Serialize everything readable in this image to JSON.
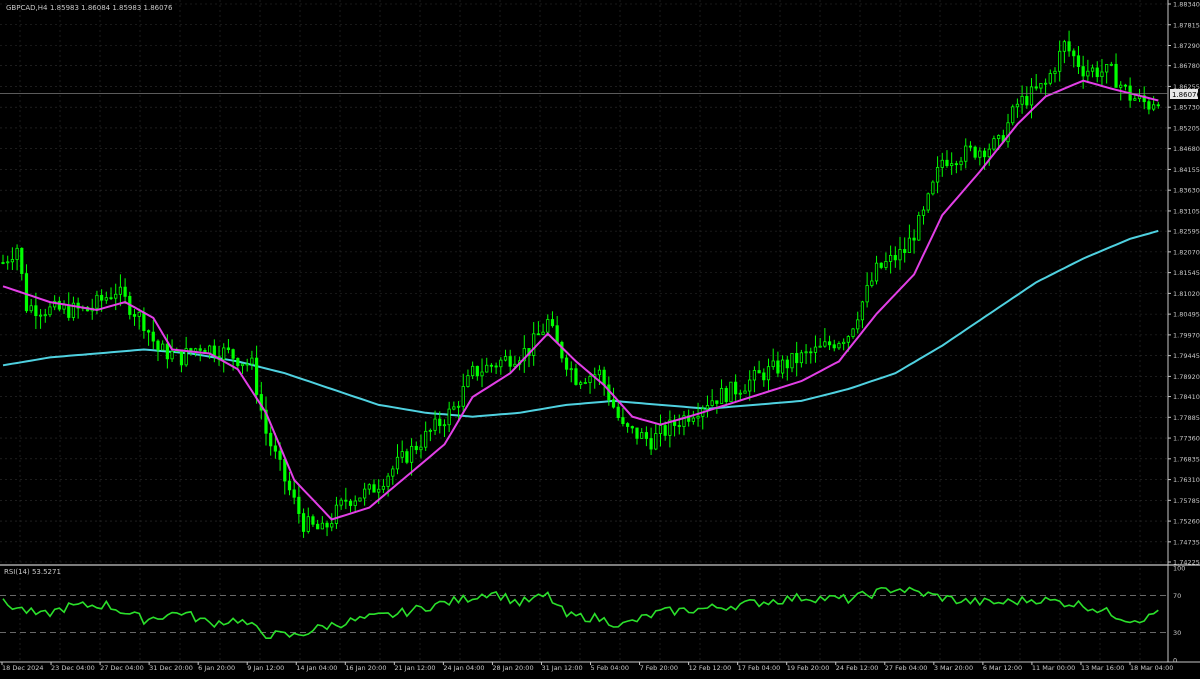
{
  "header": {
    "symbol_timeframe": "GBPCAD,H4",
    "ohlc_text": "1.85983 1.86084 1.85983 1.86076"
  },
  "current_price_label": "1.86076",
  "colors": {
    "background": "#000000",
    "grid": "#2f2f2f",
    "axis_text": "#c8c8c8",
    "candle": "#00ff00",
    "ma_fast": "#e23fe6",
    "ma_slow": "#4fd1e0",
    "rsi_line": "#2be02b",
    "rsi_levels": "#8a8a8a",
    "separator": "#c8c8c8",
    "price_line": "#7a7a7a"
  },
  "price_axis_labels": [
    "1.88340",
    "1.87815",
    "1.87290",
    "1.86780",
    "1.86255",
    "1.85730",
    "1.85205",
    "1.84680",
    "1.84155",
    "1.83630",
    "1.83105",
    "1.82595",
    "1.82070",
    "1.81545",
    "1.81020",
    "1.80495",
    "1.79970",
    "1.79445",
    "1.78920",
    "1.78410",
    "1.77885",
    "1.77360",
    "1.76835",
    "1.76310",
    "1.75785",
    "1.75260",
    "1.74735",
    "1.74225"
  ],
  "time_axis_labels": [
    "18 Dec 2024",
    "23 Dec 04:00",
    "27 Dec 04:00",
    "31 Dec 20:00",
    "6 Jan 20:00",
    "9 Jan 12:00",
    "14 Jan 04:00",
    "16 Jan 20:00",
    "21 Jan 12:00",
    "24 Jan 04:00",
    "28 Jan 20:00",
    "31 Jan 12:00",
    "5 Feb 04:00",
    "7 Feb 20:00",
    "12 Feb 12:00",
    "17 Feb 04:00",
    "19 Feb 20:00",
    "24 Feb 12:00",
    "27 Feb 04:00",
    "3 Mar 20:00",
    "6 Mar 12:00",
    "11 Mar 00:00",
    "13 Mar 16:00",
    "18 Mar 04:00"
  ],
  "rsi": {
    "label": "RSI(14) 53.5271",
    "axis_labels": [
      "100",
      "70",
      "30",
      "0"
    ],
    "levels": [
      70,
      30
    ]
  },
  "chart_data": {
    "type": "candlestick",
    "symbol": "GBPCAD",
    "timeframe": "H4",
    "ylim": [
      1.74225,
      1.8834
    ],
    "last_price": 1.86076,
    "price_path_anchors": [
      [
        0,
        1.818
      ],
      [
        3,
        1.822
      ],
      [
        5,
        1.807
      ],
      [
        10,
        1.806
      ],
      [
        18,
        1.806
      ],
      [
        24,
        1.811
      ],
      [
        30,
        1.803
      ],
      [
        33,
        1.796
      ],
      [
        38,
        1.794
      ],
      [
        42,
        1.797
      ],
      [
        48,
        1.795
      ],
      [
        53,
        1.792
      ],
      [
        56,
        1.775
      ],
      [
        60,
        1.763
      ],
      [
        64,
        1.752
      ],
      [
        68,
        1.75
      ],
      [
        73,
        1.758
      ],
      [
        78,
        1.76
      ],
      [
        84,
        1.767
      ],
      [
        90,
        1.774
      ],
      [
        96,
        1.781
      ],
      [
        100,
        1.79
      ],
      [
        106,
        1.793
      ],
      [
        112,
        1.796
      ],
      [
        116,
        1.803
      ],
      [
        118,
        1.797
      ],
      [
        122,
        1.789
      ],
      [
        127,
        1.79
      ],
      [
        132,
        1.776
      ],
      [
        138,
        1.773
      ],
      [
        144,
        1.778
      ],
      [
        150,
        1.783
      ],
      [
        156,
        1.786
      ],
      [
        162,
        1.79
      ],
      [
        168,
        1.793
      ],
      [
        174,
        1.796
      ],
      [
        180,
        1.8
      ],
      [
        186,
        1.816
      ],
      [
        192,
        1.821
      ],
      [
        196,
        1.83
      ],
      [
        200,
        1.844
      ],
      [
        206,
        1.846
      ],
      [
        212,
        1.848
      ],
      [
        216,
        1.858
      ],
      [
        222,
        1.863
      ],
      [
        226,
        1.873
      ],
      [
        230,
        1.867
      ],
      [
        236,
        1.866
      ],
      [
        240,
        1.86
      ],
      [
        244,
        1.858
      ],
      [
        246,
        1.86
      ]
    ],
    "moving_average_fast": [
      [
        0,
        1.812
      ],
      [
        10,
        1.808
      ],
      [
        20,
        1.806
      ],
      [
        26,
        1.808
      ],
      [
        32,
        1.804
      ],
      [
        36,
        1.796
      ],
      [
        44,
        1.795
      ],
      [
        50,
        1.791
      ],
      [
        56,
        1.78
      ],
      [
        62,
        1.763
      ],
      [
        70,
        1.753
      ],
      [
        78,
        1.756
      ],
      [
        86,
        1.764
      ],
      [
        94,
        1.772
      ],
      [
        100,
        1.784
      ],
      [
        108,
        1.79
      ],
      [
        116,
        1.8
      ],
      [
        122,
        1.793
      ],
      [
        128,
        1.787
      ],
      [
        134,
        1.779
      ],
      [
        140,
        1.777
      ],
      [
        146,
        1.779
      ],
      [
        154,
        1.782
      ],
      [
        162,
        1.785
      ],
      [
        170,
        1.788
      ],
      [
        178,
        1.793
      ],
      [
        186,
        1.805
      ],
      [
        194,
        1.815
      ],
      [
        200,
        1.83
      ],
      [
        208,
        1.841
      ],
      [
        216,
        1.853
      ],
      [
        222,
        1.86
      ],
      [
        230,
        1.864
      ],
      [
        236,
        1.862
      ],
      [
        246,
        1.859
      ]
    ],
    "moving_average_slow": [
      [
        0,
        1.792
      ],
      [
        10,
        1.794
      ],
      [
        20,
        1.795
      ],
      [
        30,
        1.796
      ],
      [
        40,
        1.795
      ],
      [
        50,
        1.793
      ],
      [
        60,
        1.79
      ],
      [
        70,
        1.786
      ],
      [
        80,
        1.782
      ],
      [
        90,
        1.78
      ],
      [
        100,
        1.779
      ],
      [
        110,
        1.78
      ],
      [
        120,
        1.782
      ],
      [
        130,
        1.783
      ],
      [
        140,
        1.782
      ],
      [
        150,
        1.781
      ],
      [
        160,
        1.782
      ],
      [
        170,
        1.783
      ],
      [
        180,
        1.786
      ],
      [
        190,
        1.79
      ],
      [
        200,
        1.797
      ],
      [
        210,
        1.805
      ],
      [
        220,
        1.813
      ],
      [
        230,
        1.819
      ],
      [
        240,
        1.824
      ],
      [
        246,
        1.826
      ]
    ],
    "rsi_series": [
      [
        0,
        62
      ],
      [
        8,
        48
      ],
      [
        14,
        58
      ],
      [
        22,
        60
      ],
      [
        30,
        44
      ],
      [
        38,
        52
      ],
      [
        44,
        40
      ],
      [
        50,
        44
      ],
      [
        56,
        28
      ],
      [
        62,
        26
      ],
      [
        68,
        36
      ],
      [
        76,
        44
      ],
      [
        84,
        50
      ],
      [
        92,
        60
      ],
      [
        98,
        66
      ],
      [
        104,
        74
      ],
      [
        110,
        62
      ],
      [
        116,
        70
      ],
      [
        120,
        48
      ],
      [
        126,
        46
      ],
      [
        132,
        38
      ],
      [
        140,
        52
      ],
      [
        150,
        56
      ],
      [
        160,
        62
      ],
      [
        170,
        68
      ],
      [
        180,
        66
      ],
      [
        190,
        78
      ],
      [
        198,
        70
      ],
      [
        204,
        64
      ],
      [
        212,
        62
      ],
      [
        220,
        66
      ],
      [
        230,
        60
      ],
      [
        240,
        44
      ],
      [
        244,
        46
      ],
      [
        246,
        54
      ]
    ]
  }
}
